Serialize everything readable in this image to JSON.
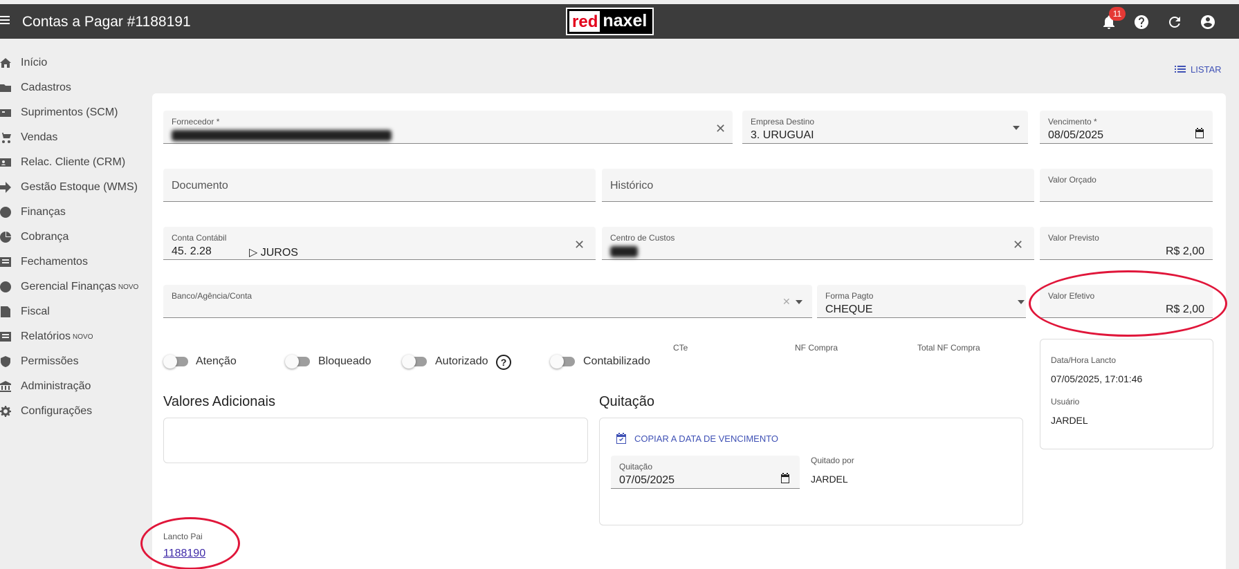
{
  "header": {
    "title": "Contas a Pagar #1188191",
    "logo_red": "red",
    "logo_rest": "naxel",
    "notification_count": "11"
  },
  "sidebar": {
    "items": [
      {
        "label": "Início",
        "icon": "home-icon"
      },
      {
        "label": "Cadastros",
        "icon": "folder-icon"
      },
      {
        "label": "Suprimentos (SCM)",
        "icon": "box-icon"
      },
      {
        "label": "Vendas",
        "icon": "cart-icon"
      },
      {
        "label": "Relac. Cliente (CRM)",
        "icon": "contacts-icon"
      },
      {
        "label": "Gestão Estoque (WMS)",
        "icon": "arrow-icon"
      },
      {
        "label": "Finanças",
        "icon": "dollar-icon"
      },
      {
        "label": "Cobrança",
        "icon": "pie-icon"
      },
      {
        "label": "Fechamentos",
        "icon": "list-icon"
      },
      {
        "label": "Gerencial Finanças",
        "icon": "dollar-icon",
        "sup": "NOVO"
      },
      {
        "label": "Fiscal",
        "icon": "doc-icon"
      },
      {
        "label": "Relatórios",
        "icon": "report-icon",
        "sup": "NOVO"
      },
      {
        "label": "Permissões",
        "icon": "shield-icon"
      },
      {
        "label": "Administração",
        "icon": "bank-icon"
      },
      {
        "label": "Configurações",
        "icon": "gear-icon"
      }
    ]
  },
  "toolbar": {
    "listar_label": "LISTAR"
  },
  "form": {
    "fornecedor": {
      "label": "Fornecedor *"
    },
    "empresa": {
      "label": "Empresa Destino",
      "value": "3. URUGUAI"
    },
    "vencimento": {
      "label": "Vencimento *",
      "value": "08/05/2025"
    },
    "documento": {
      "placeholder": "Documento"
    },
    "historico": {
      "placeholder": "Histórico"
    },
    "valor_orcado": {
      "label": "Valor Orçado"
    },
    "conta_contabil": {
      "label": "Conta Contábil",
      "code": "45. 2.28",
      "name": "▷ JUROS"
    },
    "centro_custos": {
      "label": "Centro de Custos",
      "value": "CDP"
    },
    "valor_previsto": {
      "label": "Valor Previsto",
      "value": "R$ 2,00"
    },
    "banco": {
      "label": "Banco/Agência/Conta"
    },
    "forma_pagto": {
      "label": "Forma Pagto",
      "value": "CHEQUE"
    },
    "valor_efetivo": {
      "label": "Valor Efetivo",
      "value": "R$ 2,00"
    }
  },
  "toggles": {
    "atencao": "Atenção",
    "bloqueado": "Bloqueado",
    "autorizado": "Autorizado",
    "contabilizado": "Contabilizado"
  },
  "extra_labels": {
    "cte": "CTe",
    "nf_compra": "NF Compra",
    "total_nf_compra": "Total NF Compra"
  },
  "info": {
    "data_hora_label": "Data/Hora Lancto",
    "data_hora_value": "07/05/2025, 17:01:46",
    "usuario_label": "Usuário",
    "usuario_value": "JARDEL"
  },
  "valores_adicionais": {
    "title": "Valores Adicionais"
  },
  "quitacao": {
    "title": "Quitação",
    "copy_label": "COPIAR A DATA DE VENCIMENTO",
    "date_label": "Quitação",
    "date_value": "07/05/2025",
    "quitado_por_label": "Quitado por",
    "quitado_por_value": "JARDEL"
  },
  "lancto_pai": {
    "label": "Lancto Pai",
    "value": "1188190"
  },
  "colors": {
    "accent": "#3f51b5",
    "topbar": "#3c3c3c",
    "highlight": "#e0163a"
  }
}
